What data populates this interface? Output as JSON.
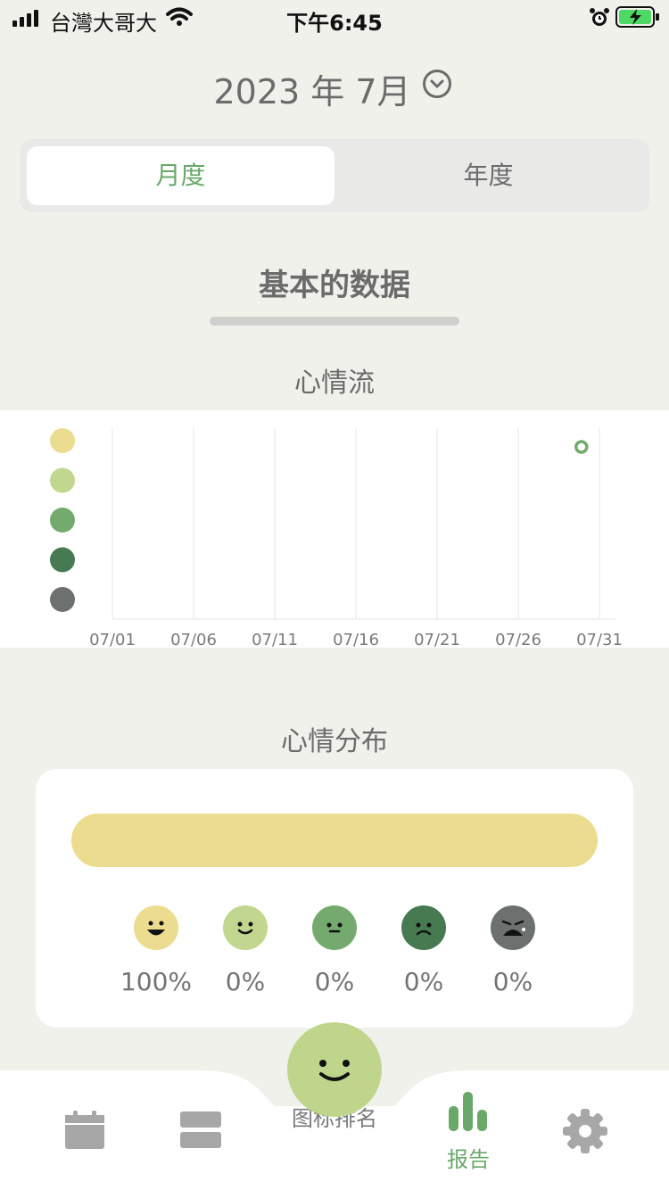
{
  "status_bar": {
    "carrier": "台灣大哥大",
    "time": "下午6:45"
  },
  "header": {
    "month_label": "2023 年 7月"
  },
  "tabs": [
    {
      "label": "月度",
      "active": true
    },
    {
      "label": "年度",
      "active": false
    }
  ],
  "section": {
    "title": "基本的数据"
  },
  "mood_flow": {
    "title": "心情流",
    "chart_data": {
      "type": "scatter",
      "x_ticks": [
        "07/01",
        "07/06",
        "07/11",
        "07/16",
        "07/21",
        "07/26",
        "07/31"
      ],
      "y_levels": [
        "level-5",
        "level-4",
        "level-3",
        "level-2",
        "level-1"
      ],
      "level_colors": [
        "#ecdc8f",
        "#c1d68f",
        "#74aa6e",
        "#477a51",
        "#6c716f"
      ],
      "points": [
        {
          "date": "07/30",
          "level": 1
        }
      ],
      "grid": true
    }
  },
  "mood_distribution": {
    "title": "心情分布",
    "chart_data": {
      "type": "bar",
      "categories": [
        "great",
        "good",
        "okay",
        "bad",
        "awful"
      ],
      "values": [
        100,
        0,
        0,
        0,
        0
      ],
      "labels": [
        "100%",
        "0%",
        "0%",
        "0%",
        "0%"
      ],
      "colors": [
        "#ecdc8f",
        "#c1d68f",
        "#74aa6e",
        "#477a51",
        "#6c716f"
      ]
    }
  },
  "tab_bar": {
    "items": [
      {
        "label": "",
        "icon": "calendar-icon"
      },
      {
        "label": "",
        "icon": "list-icon"
      },
      {
        "label": "图标排名",
        "icon": "add-mood-fab"
      },
      {
        "label": "报告",
        "icon": "bar-chart-icon",
        "active": true
      },
      {
        "label": "",
        "icon": "gear-icon"
      }
    ],
    "accent": "#6aa86a"
  }
}
